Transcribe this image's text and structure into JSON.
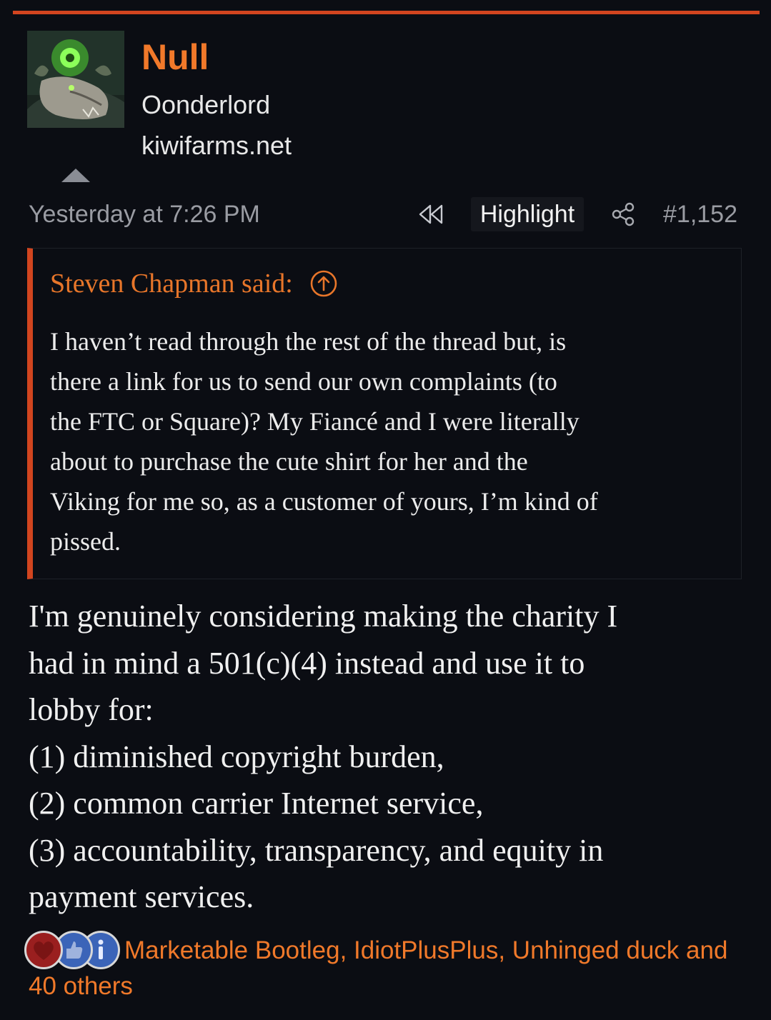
{
  "theme": {
    "accent": "#d2451f",
    "username_color": "#f1792a",
    "background": "#0b0d13"
  },
  "user": {
    "name": "Null",
    "title": "Oonderlord",
    "site": "kiwifarms.net",
    "avatar_icon": "avatar-image"
  },
  "post_meta": {
    "date": "Yesterday at 7:26 PM",
    "highlight_label": "Highlight",
    "post_number": "#1,152",
    "icons": [
      "rewind-icon",
      "share-icon",
      "collapse-arrow-icon"
    ]
  },
  "quote": {
    "author": "Steven Chapman said:",
    "lines": [
      "I haven’t read through the rest of the thread but, is",
      "there a link for us to send our own complaints (to",
      "the FTC or Square)? My Fiancé and I were literally",
      "about to purchase the cute shirt for her and the",
      "Viking for me so, as a customer of yours, I’m kind of",
      "pissed."
    ]
  },
  "body": {
    "lines": [
      "I'm genuinely considering making the charity I",
      "had in mind a 501(c)(4) instead and use it to",
      "lobby for:",
      "(1) diminished copyright burden,",
      "(2) common carrier Internet service,",
      "(3) accountability, transparency, and equity in",
      "payment services."
    ]
  },
  "reactions": {
    "icons": [
      "heart-reaction-icon",
      "like-reaction-icon",
      "informative-reaction-icon"
    ],
    "summary": "Marketable Bootleg, IdiotPlusPlus, Unhinged duck and 40 others"
  }
}
